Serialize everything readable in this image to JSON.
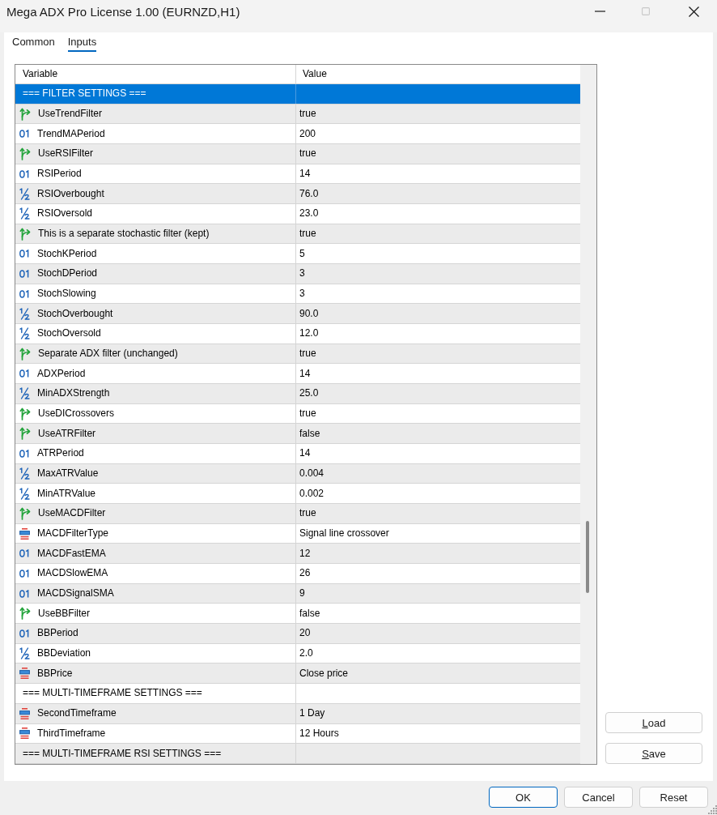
{
  "window": {
    "title": "Mega ADX Pro License 1.00 (EURNZD,H1)",
    "controls": [
      {
        "kind": "minimize",
        "disabled": false
      },
      {
        "kind": "maximize",
        "disabled": true
      },
      {
        "kind": "close",
        "disabled": false
      }
    ]
  },
  "tabs": [
    {
      "label": "Common",
      "selected": false
    },
    {
      "label": "Inputs",
      "selected": true
    }
  ],
  "table": {
    "columns": [
      "Variable",
      "Value"
    ],
    "rows": [
      {
        "kind": "section",
        "variable": "=== FILTER SETTINGS ===",
        "selected": true
      },
      {
        "kind": "bool",
        "variable": "UseTrendFilter",
        "value": "true",
        "selected": false
      },
      {
        "kind": "int",
        "variable": "TrendMAPeriod",
        "value": "200",
        "selected": false
      },
      {
        "kind": "bool",
        "variable": "UseRSIFilter",
        "value": "true",
        "selected": false
      },
      {
        "kind": "int",
        "variable": "RSIPeriod",
        "value": "14",
        "selected": false
      },
      {
        "kind": "double",
        "variable": "RSIOverbought",
        "value": "76.0",
        "selected": false
      },
      {
        "kind": "double",
        "variable": "RSIOversold",
        "value": "23.0",
        "selected": false
      },
      {
        "kind": "bool",
        "variable": "This is a separate stochastic filter (kept)",
        "value": "true",
        "selected": false
      },
      {
        "kind": "int",
        "variable": "StochKPeriod",
        "value": "5",
        "selected": false
      },
      {
        "kind": "int",
        "variable": "StochDPeriod",
        "value": "3",
        "selected": false
      },
      {
        "kind": "int",
        "variable": "StochSlowing",
        "value": "3",
        "selected": false
      },
      {
        "kind": "double",
        "variable": "StochOverbought",
        "value": "90.0",
        "selected": false
      },
      {
        "kind": "double",
        "variable": "StochOversold",
        "value": "12.0",
        "selected": false
      },
      {
        "kind": "bool",
        "variable": "Separate ADX filter (unchanged)",
        "value": "true",
        "selected": false
      },
      {
        "kind": "int",
        "variable": "ADXPeriod",
        "value": "14",
        "selected": false
      },
      {
        "kind": "double",
        "variable": "MinADXStrength",
        "value": "25.0",
        "selected": false
      },
      {
        "kind": "bool",
        "variable": "UseDICrossovers",
        "value": "true",
        "selected": false
      },
      {
        "kind": "bool",
        "variable": "UseATRFilter",
        "value": "false",
        "selected": false
      },
      {
        "kind": "int",
        "variable": "ATRPeriod",
        "value": "14",
        "selected": false
      },
      {
        "kind": "double",
        "variable": "MaxATRValue",
        "value": "0.004",
        "selected": false
      },
      {
        "kind": "double",
        "variable": "MinATRValue",
        "value": "0.002",
        "selected": false
      },
      {
        "kind": "bool",
        "variable": "UseMACDFilter",
        "value": "true",
        "selected": false
      },
      {
        "kind": "enum",
        "variable": "MACDFilterType",
        "value": "Signal line crossover",
        "selected": false
      },
      {
        "kind": "int",
        "variable": "MACDFastEMA",
        "value": "12",
        "selected": false
      },
      {
        "kind": "int",
        "variable": "MACDSlowEMA",
        "value": "26",
        "selected": false
      },
      {
        "kind": "int",
        "variable": "MACDSignalSMA",
        "value": "9",
        "selected": false
      },
      {
        "kind": "bool",
        "variable": "UseBBFilter",
        "value": "false",
        "selected": false
      },
      {
        "kind": "int",
        "variable": "BBPeriod",
        "value": "20",
        "selected": false
      },
      {
        "kind": "double",
        "variable": "BBDeviation",
        "value": "2.0",
        "selected": false
      },
      {
        "kind": "enum",
        "variable": "BBPrice",
        "value": "Close price",
        "selected": false
      },
      {
        "kind": "section",
        "variable": "=== MULTI-TIMEFRAME SETTINGS ===",
        "selected": false
      },
      {
        "kind": "enum",
        "variable": "SecondTimeframe",
        "value": "1 Day",
        "selected": false
      },
      {
        "kind": "enum",
        "variable": "ThirdTimeframe",
        "value": "12 Hours",
        "selected": false
      },
      {
        "kind": "section",
        "variable": "=== MULTI-TIMEFRAME RSI SETTINGS ===",
        "selected": false
      }
    ]
  },
  "side_buttons": [
    {
      "label": "Load",
      "mnemonic": true
    },
    {
      "label": "Save",
      "mnemonic": true
    }
  ],
  "footer_buttons": [
    {
      "label": "OK",
      "default": true
    },
    {
      "label": "Cancel",
      "default": false
    },
    {
      "label": "Reset",
      "default": false
    }
  ]
}
